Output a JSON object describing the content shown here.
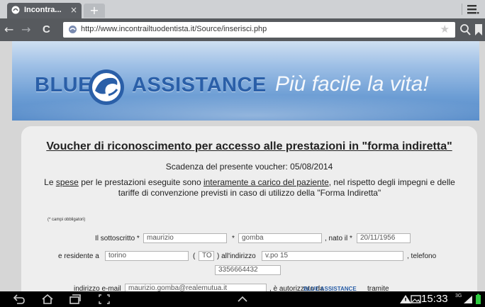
{
  "browser": {
    "tab_title": "Incontra...",
    "tab_close": "×",
    "new_tab": "+",
    "back": "←",
    "forward": "→",
    "reload": "C",
    "url": "http://www.incontrailtuodentista.it/Source/inserisci.php",
    "bookmark_star": "★"
  },
  "banner": {
    "brand_left": "BLUE",
    "brand_right": "ASSISTANCE",
    "tagline": "Più facile la vita!"
  },
  "form": {
    "title": "Voucher di riconoscimento per accesso alle prestazioni in \"forma indiretta\"",
    "deadline": "Scadenza del presente voucher: 05/08/2014",
    "notice_pre": "Le ",
    "notice_spese": "spese",
    "notice_mid": " per le prestazioni eseguite sono ",
    "notice_carico": "interamente a carico del paziente",
    "notice_post": ", nel rispetto degli impegni e delle tariffe di convenzione previsti in caso di utilizzo della \"Forma Indiretta\"",
    "required_note": "(* campi obbligatori)",
    "undersigned_label": "Il sottoscritto *",
    "first_name": "maurizio",
    "surname_star": "*",
    "surname": "gomba",
    "born_label": ", nato il *",
    "birth_date": "20/11/1956",
    "resident_label": "e residente a",
    "city": "torino",
    "province_open": "(",
    "province": "TO",
    "address_label": ") all'indirizzo",
    "address": "v.po 15",
    "phone_label": ", telefono",
    "phone": "3356664432",
    "email_label": "indirizzo e-mail",
    "email": "maurizio.gomba@realemutua.it",
    "authorized_label": ", è autorizzato da",
    "partner_brand": "BLUE ASSISTANCE",
    "through_label": "tramite"
  },
  "system": {
    "clock": "15:33",
    "network": "3G"
  },
  "colors": {
    "brand_blue": "#2a5fa8",
    "toolbar": "#575a5e",
    "tab": "#5b5e63"
  }
}
